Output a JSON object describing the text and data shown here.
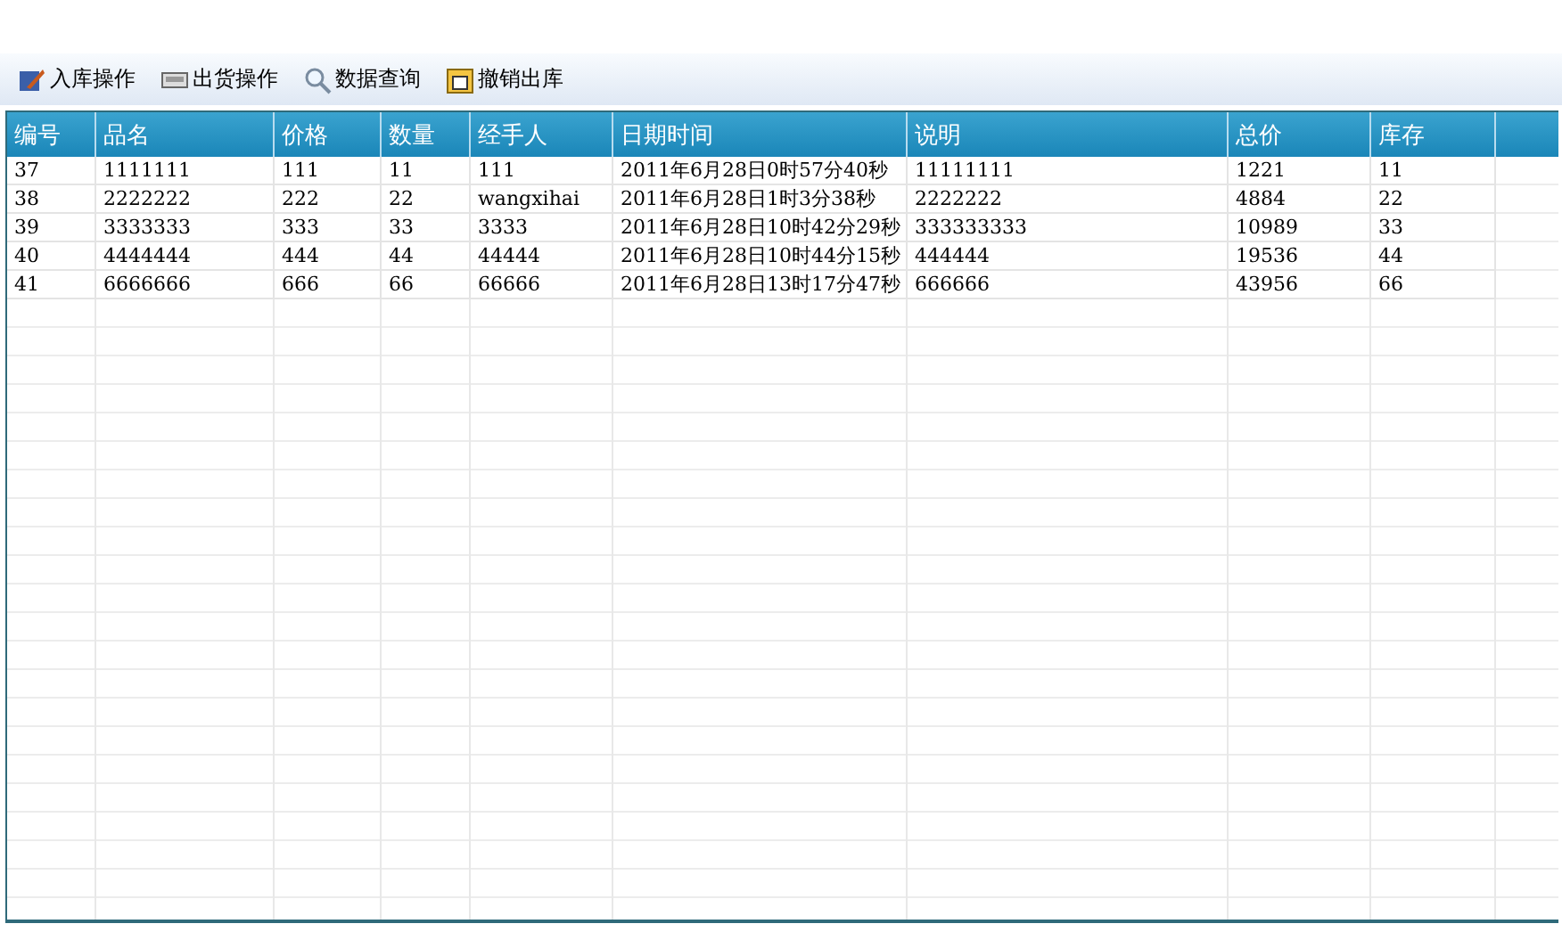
{
  "toolbar": [
    {
      "label": "入库操作"
    },
    {
      "label": "出货操作"
    },
    {
      "label": "数据查询"
    },
    {
      "label": "撤销出库"
    }
  ],
  "table": {
    "columns": [
      "编号",
      "品名",
      "价格",
      "数量",
      "经手人",
      "日期时间",
      "说明",
      "总价",
      "库存"
    ],
    "rows": [
      [
        "37",
        "1111111",
        "111",
        "11",
        "111",
        "2011年6月28日0时57分40秒",
        "11111111",
        "1221",
        "11"
      ],
      [
        "38",
        "2222222",
        "222",
        "22",
        "wangxihai",
        "2011年6月28日1时3分38秒",
        "2222222",
        "4884",
        "22"
      ],
      [
        "39",
        "3333333",
        "333",
        "33",
        "3333",
        "2011年6月28日10时42分29秒",
        "333333333",
        "10989",
        "33"
      ],
      [
        "40",
        "4444444",
        "444",
        "44",
        "44444",
        "2011年6月28日10时44分15秒",
        "444444",
        "19536",
        "44"
      ],
      [
        "41",
        "6666666",
        "666",
        "66",
        "66666",
        "2011年6月28日13时17分47秒",
        "666666",
        "43956",
        "66"
      ]
    ]
  }
}
